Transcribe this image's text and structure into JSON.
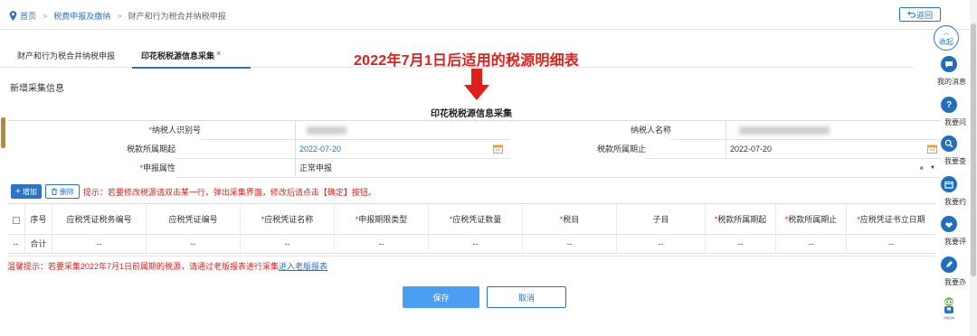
{
  "breadcrumb": {
    "home": "首页",
    "level1": "税费申报及缴纳",
    "current": "财产和行为税合并纳税申报"
  },
  "back_label": "返回",
  "tabs": [
    {
      "label": "财产和行为税合并纳税申报"
    },
    {
      "label": "印花税税源信息采集",
      "close": "×"
    }
  ],
  "annotation": "2022年7月1日后适用的税源明细表",
  "section_title": "新增采集信息",
  "form_title": "印花税税源信息采集",
  "form": {
    "taxpayer_id_label": "纳税人识别号",
    "taxpayer_name_label": "纳税人名称",
    "period_start_label": "税款所属期起",
    "period_start_value": "2022-07-20",
    "period_end_label": "税款所属期止",
    "period_end_value": "2022-07-20",
    "declare_attr_label": "申报属性",
    "declare_attr_value": "正常申报",
    "clear_mark": "×",
    "req_mark": "*"
  },
  "toolbar": {
    "add_label": "增加",
    "delete_label": "删除",
    "tip": "提示：若要修改税源请双击某一行，弹出采集界面，修改后请点击【确定】按钮。"
  },
  "grid": {
    "headers": [
      "序号",
      "应税凭证税务编号",
      "应税凭证编号",
      "应税凭证名称",
      "申报期限类型",
      "应税凭证数量",
      "税目",
      "子目",
      "税款所属期起",
      "税款所属期止",
      "应税凭证书立日期"
    ],
    "total_row": [
      "--",
      "合计",
      "--",
      "--",
      "--",
      "--",
      "--",
      "--",
      "--",
      "--",
      "--",
      "--"
    ]
  },
  "warm_tip": {
    "text": "温馨提示：若要采集2022年7月1日前属期的税源，请通过老版报表进行采集",
    "link": "进入老版报表"
  },
  "buttons": {
    "save": "保存",
    "cancel": "取消"
  },
  "sidebar": {
    "collapse": "收起",
    "items": [
      {
        "label": "我的消息",
        "icon": "message-icon"
      },
      {
        "label": "我要问",
        "icon": "question-icon"
      },
      {
        "label": "我要查",
        "icon": "search-icon"
      },
      {
        "label": "我要约",
        "icon": "calendar-icon"
      },
      {
        "label": "我要评",
        "icon": "rating-icon"
      },
      {
        "label": "我要办",
        "icon": "edit-icon"
      }
    ],
    "robot_label": "智能咨询"
  },
  "colors": {
    "primary": "#2a73c6",
    "annotation_red": "#e0201b",
    "save_button": "#4b9ff2",
    "calendar_orange": "#f0a030"
  }
}
